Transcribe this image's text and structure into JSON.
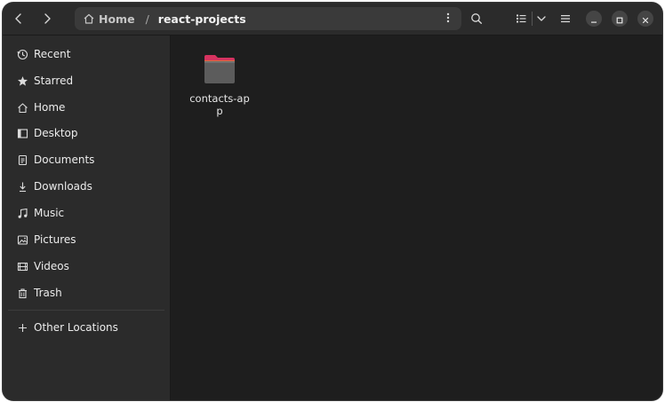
{
  "header": {
    "back_icon": "chevron-left-icon",
    "forward_icon": "chevron-right-icon",
    "path": {
      "home_label": "Home",
      "separator": "/",
      "current_label": "react-projects"
    },
    "search_icon": "search-icon",
    "view_icon": "list-view-icon",
    "view_options_icon": "chevron-down-icon",
    "menu_icon": "hamburger-menu-icon"
  },
  "sidebar": {
    "items": [
      {
        "label": "Recent",
        "icon": "clock-icon"
      },
      {
        "label": "Starred",
        "icon": "star-icon"
      },
      {
        "label": "Home",
        "icon": "home-icon"
      },
      {
        "label": "Desktop",
        "icon": "desktop-icon"
      },
      {
        "label": "Documents",
        "icon": "document-icon"
      },
      {
        "label": "Downloads",
        "icon": "download-icon"
      },
      {
        "label": "Music",
        "icon": "music-icon"
      },
      {
        "label": "Pictures",
        "icon": "picture-icon"
      },
      {
        "label": "Videos",
        "icon": "video-icon"
      },
      {
        "label": "Trash",
        "icon": "trash-icon"
      }
    ],
    "other_locations": {
      "label": "Other Locations",
      "icon": "plus-icon"
    }
  },
  "files": [
    {
      "name": "contacts-app",
      "type": "folder",
      "icon": "folder-icon"
    }
  ],
  "colors": {
    "window_bg": "#1e1e1e",
    "sidebar_bg": "#2b2b2b",
    "folder_tab": "#d6335f",
    "folder_body": "#5c5c5c"
  }
}
